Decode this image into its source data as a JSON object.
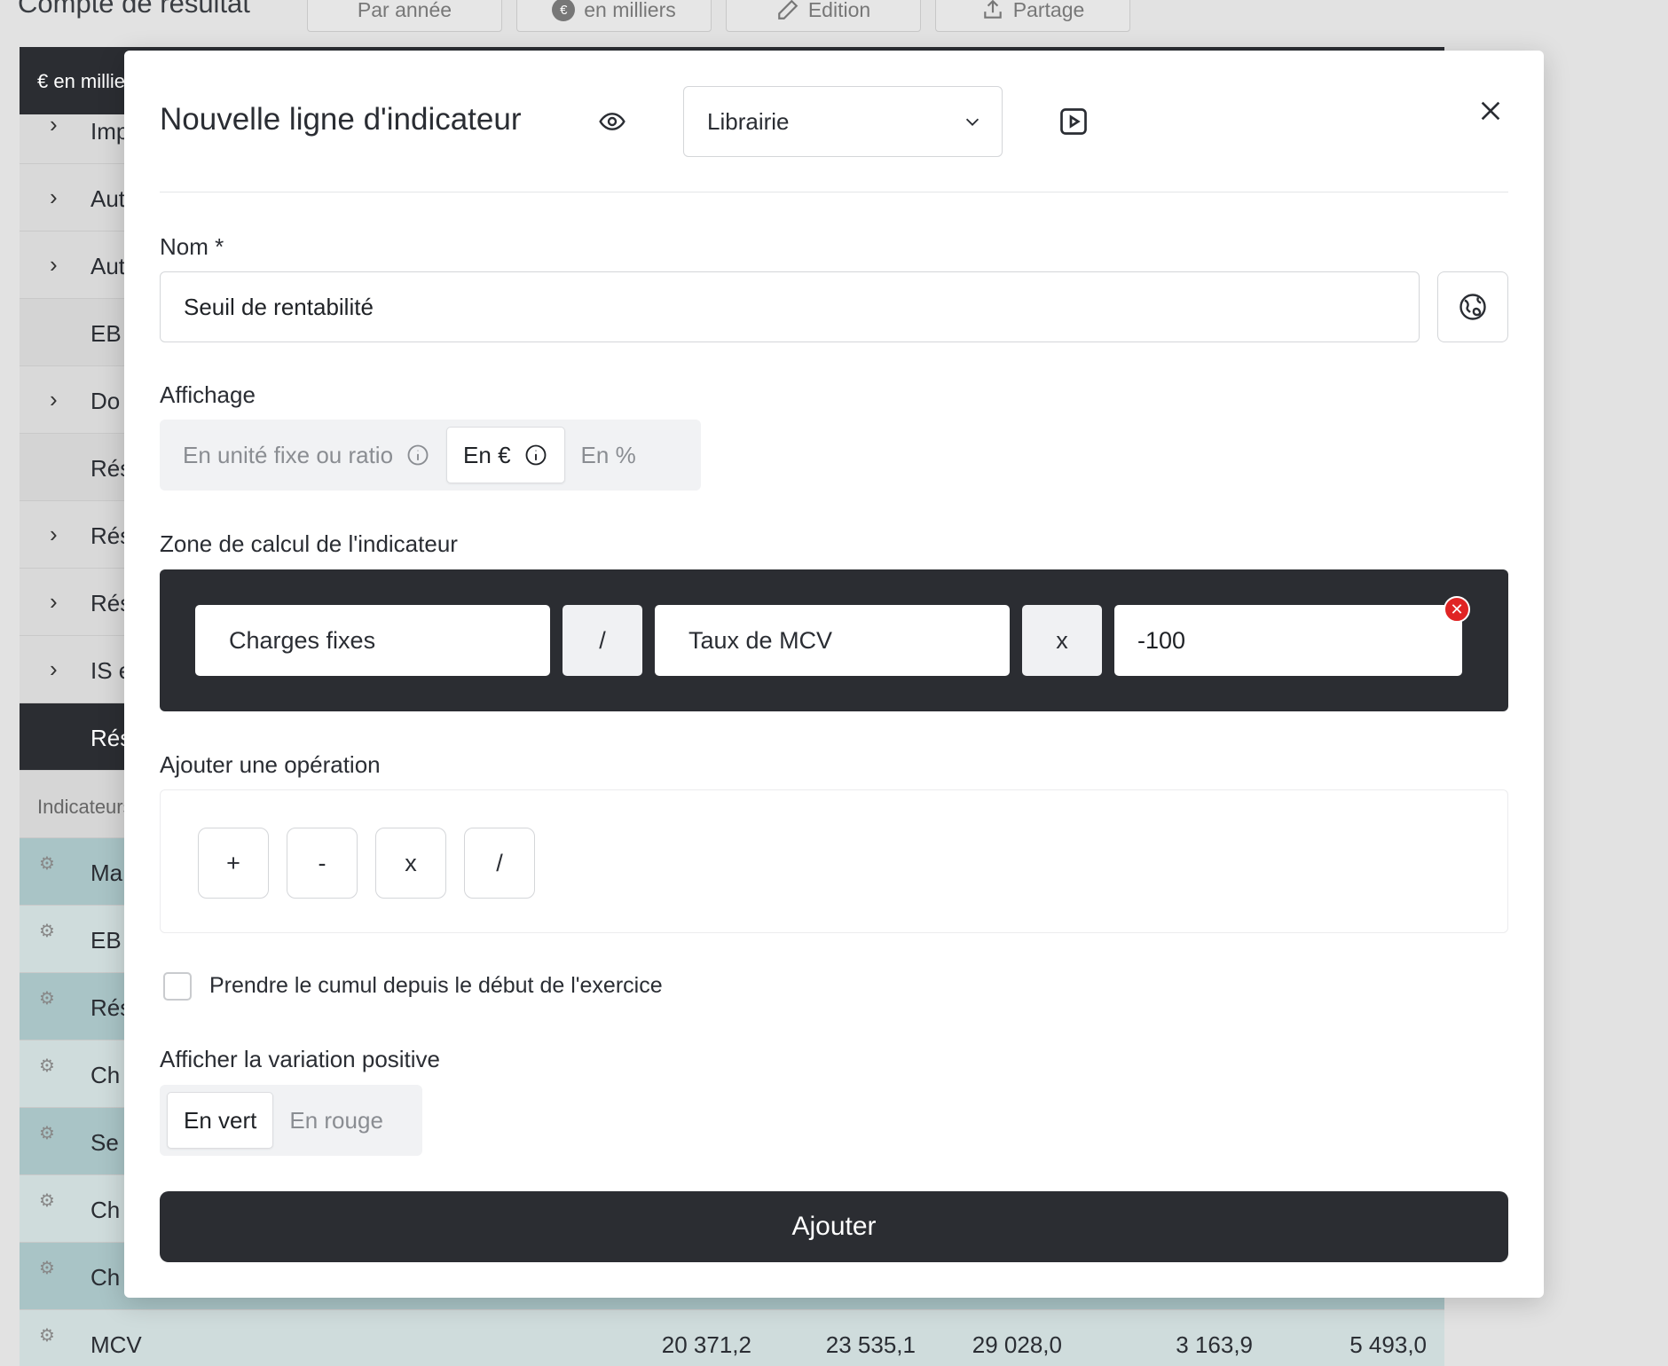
{
  "background": {
    "page_title": "Compte de résultat",
    "toolbar": {
      "by_year": "Par année",
      "thousands": "en milliers",
      "thousands_badge": "€",
      "edit": "Edition",
      "share": "Partage"
    },
    "table_header": "€ en milliers",
    "rows": [
      {
        "label": "Imp"
      },
      {
        "label": "Aut"
      },
      {
        "label": "Aut"
      },
      {
        "label": "EB"
      },
      {
        "label": "Do"
      },
      {
        "label": "Rés"
      },
      {
        "label": "Rés"
      },
      {
        "label": "Rés"
      },
      {
        "label": "IS e"
      },
      {
        "label": "Rés"
      }
    ],
    "indicators_section": "Indicateurs",
    "indicator_rows": [
      {
        "label": "Ma"
      },
      {
        "label": "EB"
      },
      {
        "label": "Rés"
      },
      {
        "label": "Ch"
      },
      {
        "label": "Se"
      },
      {
        "label": "Ch"
      },
      {
        "label": "Ch"
      }
    ],
    "mcv_row": {
      "label": "MCV",
      "values": [
        "20 371,2",
        "23 535,1",
        "29 028,0",
        "3 163,9",
        "5 493,0"
      ]
    }
  },
  "modal": {
    "title": "Nouvelle ligne d'indicateur",
    "library_select": "Librairie",
    "name_label": "Nom *",
    "name_value": "Seuil de rentabilité",
    "display_label": "Affichage",
    "display_options": [
      "En unité fixe ou ratio",
      "En €",
      "En %"
    ],
    "display_selected": "En €",
    "calc_label": "Zone de calcul de l'indicateur",
    "formula": {
      "operand1": "Charges fixes",
      "op1": "/",
      "operand2": "Taux de MCV",
      "op2": "x",
      "operand3": "-100"
    },
    "add_op_label": "Ajouter une opération",
    "operations": [
      "+",
      "-",
      "x",
      "/"
    ],
    "cumul_checkbox_label": "Prendre le cumul depuis le début de l'exercice",
    "cumul_checked": false,
    "variation_label": "Afficher la variation positive",
    "variation_options": [
      "En vert",
      "En rouge"
    ],
    "variation_selected": "En vert",
    "submit_label": "Ajouter"
  },
  "colors": {
    "dark": "#2b2d32",
    "remove_red": "#e02424",
    "teal_row": "#a9c4c6"
  }
}
